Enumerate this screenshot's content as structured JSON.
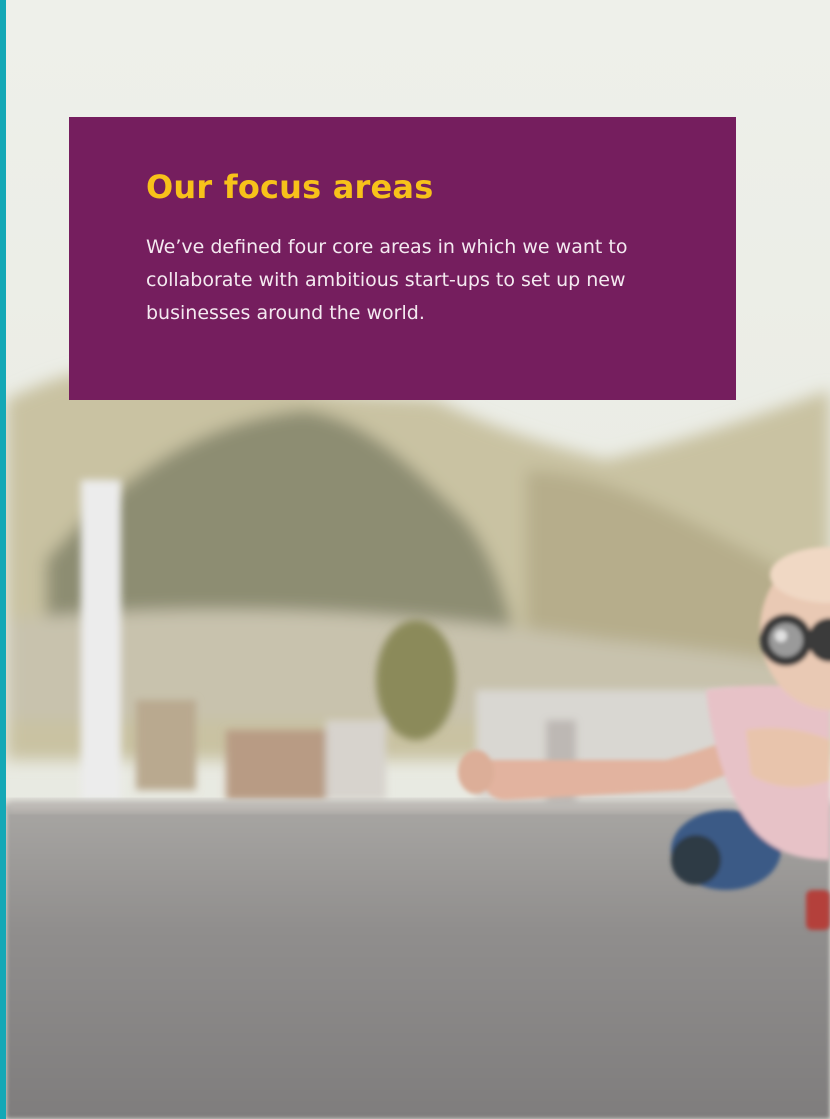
{
  "focus_card": {
    "title": "Our focus areas",
    "body": "We’ve defined four core areas in which we want to collaborate with ambitious start-ups to set up new businesses around the world."
  },
  "colors": {
    "accent_stripe": "#14a8b6",
    "card_background": "#751e5e",
    "title": "#f7c21a",
    "body_text": "#f4e9f0"
  }
}
